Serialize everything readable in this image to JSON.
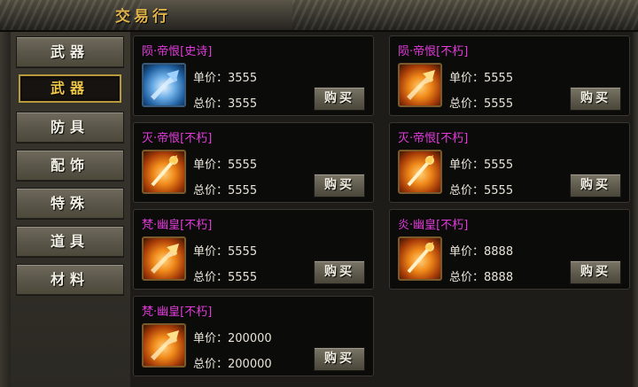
{
  "window": {
    "title": "交易行"
  },
  "sidebar": {
    "items": [
      {
        "label": "武器",
        "active": false
      },
      {
        "label": "武器",
        "active": true
      },
      {
        "label": "防具",
        "active": false
      },
      {
        "label": "配饰",
        "active": false
      },
      {
        "label": "特殊",
        "active": false
      },
      {
        "label": "道具",
        "active": false
      },
      {
        "label": "材料",
        "active": false
      }
    ]
  },
  "listings": [
    {
      "name": "陨·帝恨[史诗]",
      "unit": "单价：3555",
      "total": "总价：3555",
      "buy": "购买",
      "icon": "blue-axe-icon"
    },
    {
      "name": "陨·帝恨[不朽]",
      "unit": "单价：5555",
      "total": "总价：5555",
      "buy": "购买",
      "icon": "gold-axe-icon"
    },
    {
      "name": "灭·帝恨[不朽]",
      "unit": "单价：5555",
      "total": "总价：5555",
      "buy": "购买",
      "icon": "gold-staff-icon"
    },
    {
      "name": "灭·帝恨[不朽]",
      "unit": "单价：5555",
      "total": "总价：5555",
      "buy": "购买",
      "icon": "gold-staff-icon"
    },
    {
      "name": "梵·幽皇[不朽]",
      "unit": "单价：5555",
      "total": "总价：5555",
      "buy": "购买",
      "icon": "gold-axe-icon"
    },
    {
      "name": "炎·幽皇[不朽]",
      "unit": "单价：8888",
      "total": "总价：8888",
      "buy": "购买",
      "icon": "gold-staff-icon"
    },
    {
      "name": "梵·幽皇[不朽]",
      "unit": "单价：200000",
      "total": "总价：200000",
      "buy": "购买",
      "icon": "gold-axe-icon"
    }
  ],
  "colors": {
    "name": "#e43bdc",
    "tab_active": "#f0c84a",
    "title": "#e0b24a"
  }
}
